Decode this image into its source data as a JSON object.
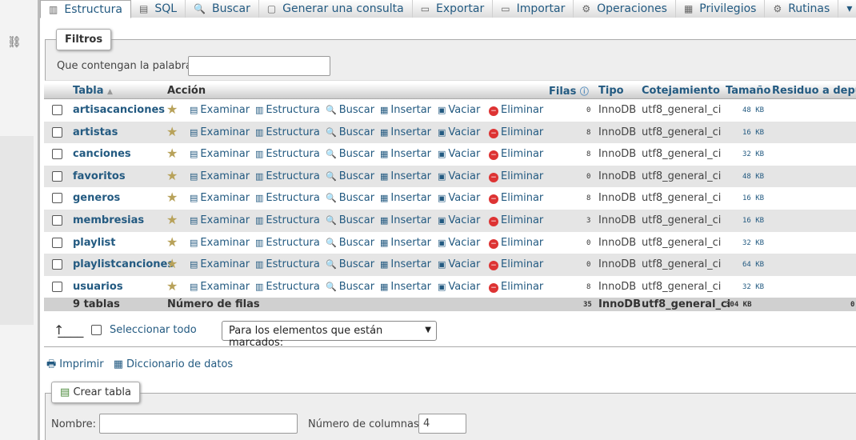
{
  "tabs": [
    {
      "label": "Estructura",
      "icon": "structure-icon",
      "active": true
    },
    {
      "label": "SQL",
      "icon": "sql-icon"
    },
    {
      "label": "Buscar",
      "icon": "search-icon"
    },
    {
      "label": "Generar una consulta",
      "icon": "query-icon"
    },
    {
      "label": "Exportar",
      "icon": "export-icon"
    },
    {
      "label": "Importar",
      "icon": "import-icon"
    },
    {
      "label": "Operaciones",
      "icon": "wrench-icon"
    },
    {
      "label": "Privilegios",
      "icon": "privileges-icon"
    },
    {
      "label": "Rutinas",
      "icon": "routines-icon"
    }
  ],
  "filters": {
    "legend": "Filtros",
    "label": "Que contengan la palabra:",
    "value": ""
  },
  "table": {
    "headers": {
      "table": "Tabla",
      "action": "Acción",
      "rows": "Filas",
      "type": "Tipo",
      "collation": "Cotejamiento",
      "size": "Tamaño",
      "overhead": "Residuo a depurar"
    },
    "actions": {
      "browse": "Examinar",
      "structure": "Estructura",
      "search": "Buscar",
      "insert": "Insertar",
      "empty": "Vaciar",
      "drop": "Eliminar"
    },
    "rows": [
      {
        "name": "artisacanciones",
        "rows": "0",
        "type": "InnoDB",
        "collation": "utf8_general_ci",
        "size": "48 KB"
      },
      {
        "name": "artistas",
        "rows": "8",
        "type": "InnoDB",
        "collation": "utf8_general_ci",
        "size": "16 KB"
      },
      {
        "name": "canciones",
        "rows": "8",
        "type": "InnoDB",
        "collation": "utf8_general_ci",
        "size": "32 KB"
      },
      {
        "name": "favoritos",
        "rows": "0",
        "type": "InnoDB",
        "collation": "utf8_general_ci",
        "size": "48 KB"
      },
      {
        "name": "generos",
        "rows": "8",
        "type": "InnoDB",
        "collation": "utf8_general_ci",
        "size": "16 KB"
      },
      {
        "name": "membresias",
        "rows": "3",
        "type": "InnoDB",
        "collation": "utf8_general_ci",
        "size": "16 KB"
      },
      {
        "name": "playlist",
        "rows": "0",
        "type": "InnoDB",
        "collation": "utf8_general_ci",
        "size": "32 KB"
      },
      {
        "name": "playlistcanciones",
        "rows": "0",
        "type": "InnoDB",
        "collation": "utf8_general_ci",
        "size": "64 KB"
      },
      {
        "name": "usuarios",
        "rows": "8",
        "type": "InnoDB",
        "collation": "utf8_general_ci",
        "size": "32 KB"
      }
    ],
    "footer": {
      "count": "9 tablas",
      "label": "Número de filas",
      "rows": "35",
      "type": "InnoDB",
      "collation": "utf8_general_ci",
      "size": "304 KB",
      "overhead": "0"
    }
  },
  "selection": {
    "select_all": "Seleccionar todo",
    "dropdown": "Para los elementos que están marcados:"
  },
  "links": {
    "print": "Imprimir",
    "dictionary": "Diccionario de datos"
  },
  "create": {
    "legend": "Crear tabla",
    "name_label": "Nombre:",
    "name_value": "",
    "cols_label": "Número de columnas:",
    "cols_value": "4"
  }
}
